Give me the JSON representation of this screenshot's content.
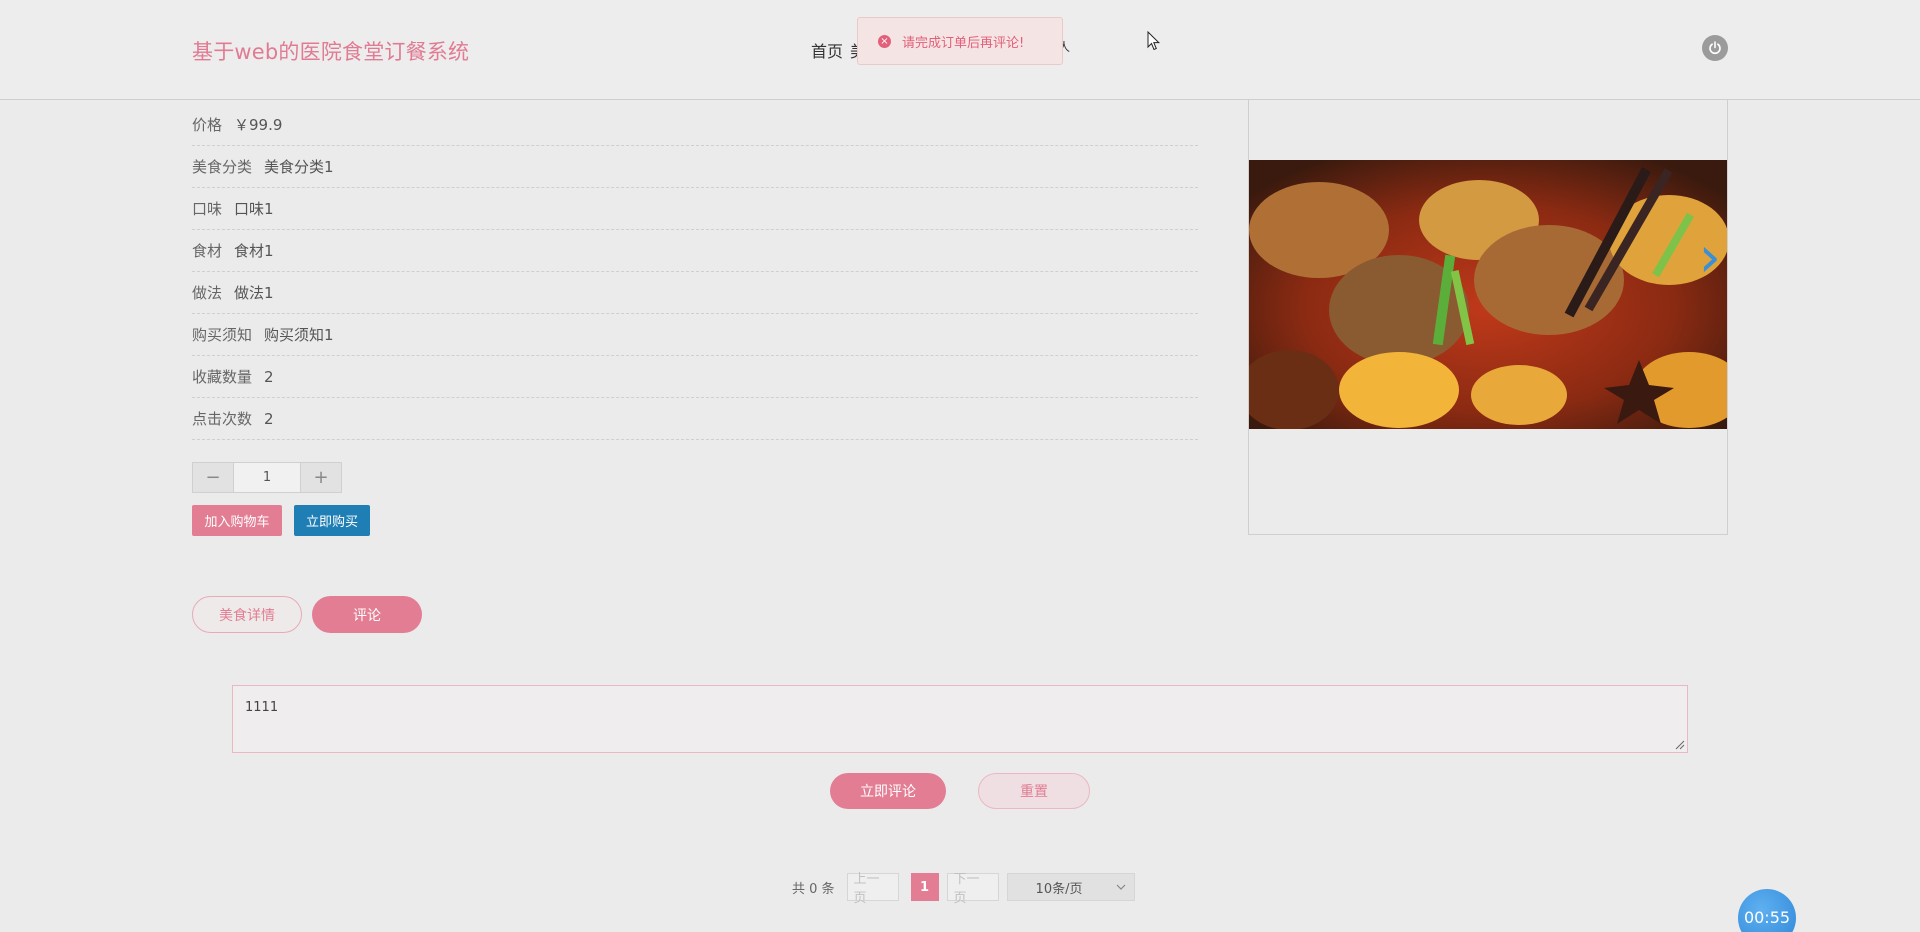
{
  "header": {
    "site_title": "基于web的医院食堂订餐系统",
    "nav_home": "首页",
    "nav_clipped_1": "美",
    "nav_clipped_2": "人"
  },
  "toast": {
    "message": "请完成订单后再评论!",
    "icon": "error-circle-icon",
    "color": "#e3607a"
  },
  "details": [
    {
      "label": "价格",
      "value": "￥99.9"
    },
    {
      "label": "美食分类",
      "value": "美食分类1"
    },
    {
      "label": "口味",
      "value": "口味1"
    },
    {
      "label": "食材",
      "value": "食材1"
    },
    {
      "label": "做法",
      "value": "做法1"
    },
    {
      "label": "购买须知",
      "value": "购买须知1"
    },
    {
      "label": "收藏数量",
      "value": "2"
    },
    {
      "label": "点击次数",
      "value": "2"
    }
  ],
  "stepper": {
    "minus": "−",
    "value": "1",
    "plus": "+"
  },
  "actions": {
    "add_to_cart": "加入购物车",
    "buy_now": "立即购买"
  },
  "carousel": {
    "next_icon": "chevron-right-icon"
  },
  "tabs": [
    {
      "label": "美食详情",
      "active": false
    },
    {
      "label": "评论",
      "active": true
    }
  ],
  "comment": {
    "value": "1111",
    "submit_label": "立即评论",
    "reset_label": "重置"
  },
  "pagination": {
    "total": "共 0 条",
    "prev": "上一页",
    "current": "1",
    "next": "下一页",
    "page_size": "10条/页"
  },
  "timer": {
    "value": "00:55"
  },
  "colors": {
    "accent": "#e27d93",
    "primary_blue": "#1f7fb5",
    "error": "#e3607a"
  }
}
